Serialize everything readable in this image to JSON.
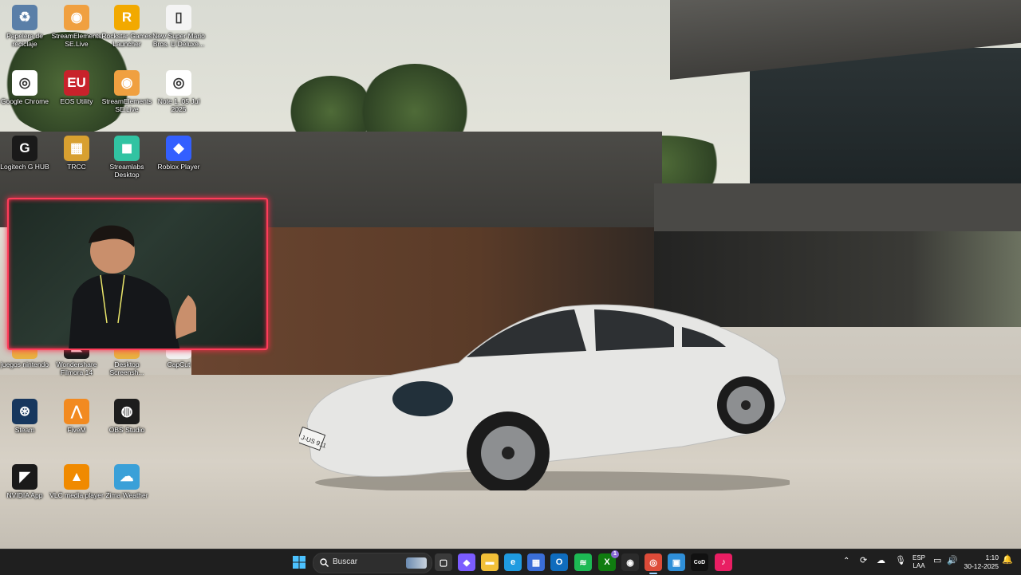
{
  "desktop": {
    "icons": [
      {
        "label": "Papelera de reciclaje",
        "icon": "recycle-bin-icon"
      },
      {
        "label": "StreamElements SE.Live",
        "icon": "streamelements-icon"
      },
      {
        "label": "Rockstar Games Launcher",
        "icon": "rockstar-icon",
        "glyph": "R★"
      },
      {
        "label": "New Super Mario Bros. U Deluxe...",
        "icon": "file-icon"
      },
      {
        "label": "Google Chrome",
        "icon": "chrome-icon"
      },
      {
        "label": "EOS Utility",
        "icon": "eos-utility-icon",
        "glyph": "EU"
      },
      {
        "label": "StreamElements SE.Live",
        "icon": "streamelements-icon"
      },
      {
        "label": "Note 1, 05 Jul 2025",
        "icon": "chrome-note-icon"
      },
      {
        "label": "Logitech G HUB",
        "icon": "logitech-icon",
        "glyph": "G"
      },
      {
        "label": "TRCC",
        "icon": "trcc-icon"
      },
      {
        "label": "Streamlabs Desktop",
        "icon": "streamlabs-icon"
      },
      {
        "label": "Roblox Player",
        "icon": "roblox-icon"
      },
      {
        "label": "juegos nintendo",
        "icon": "folder-icon"
      },
      {
        "label": "Wondershare Filmora 14",
        "icon": "filmora-icon"
      },
      {
        "label": "Desktop Screensh...",
        "icon": "folder-icon"
      },
      {
        "label": "CapCut",
        "icon": "capcut-icon"
      },
      {
        "label": "Steam",
        "icon": "steam-icon"
      },
      {
        "label": "FiveM",
        "icon": "fivem-icon"
      },
      {
        "label": "OBS Studio",
        "icon": "obs-icon"
      },
      {
        "label": "NVIDIA App",
        "icon": "nvidia-icon"
      },
      {
        "label": "VLC media player",
        "icon": "vlc-icon"
      },
      {
        "label": "Zima Weather",
        "icon": "weather-icon"
      }
    ],
    "plate": "J-US 911"
  },
  "taskbar": {
    "search_placeholder": "Buscar",
    "apps": [
      {
        "name": "task-view-icon",
        "color": "#3a3a3a",
        "glyph": "▢"
      },
      {
        "name": "copilot-icon",
        "color": "#7b5cff",
        "glyph": "◆"
      },
      {
        "name": "file-explorer-icon",
        "color": "#f2c038",
        "glyph": "▬"
      },
      {
        "name": "edge-icon",
        "color": "#1f9be0",
        "glyph": "e"
      },
      {
        "name": "store-icon",
        "color": "#3a6ed8",
        "glyph": "▦"
      },
      {
        "name": "outlook-icon",
        "color": "#0f6cbd",
        "glyph": "O"
      },
      {
        "name": "spotify-icon",
        "color": "#1db954",
        "glyph": "≋"
      },
      {
        "name": "xbox-icon",
        "color": "#107c10",
        "glyph": "X"
      },
      {
        "name": "obs-taskbar-icon",
        "color": "#2b2b2b",
        "glyph": "◉"
      },
      {
        "name": "chrome-taskbar-icon",
        "color": "#dd4b39",
        "glyph": "◎"
      },
      {
        "name": "photos-icon",
        "color": "#2f8fd8",
        "glyph": "▣"
      },
      {
        "name": "call-of-duty-icon",
        "color": "#111111",
        "glyph": "CoD"
      },
      {
        "name": "tiktok-icon",
        "color": "#e91e63",
        "glyph": "♪"
      }
    ],
    "xbox_badge": "1",
    "language": "ESP",
    "language_sub": "LAA",
    "time": "1:10",
    "date": "30-12-2025"
  }
}
